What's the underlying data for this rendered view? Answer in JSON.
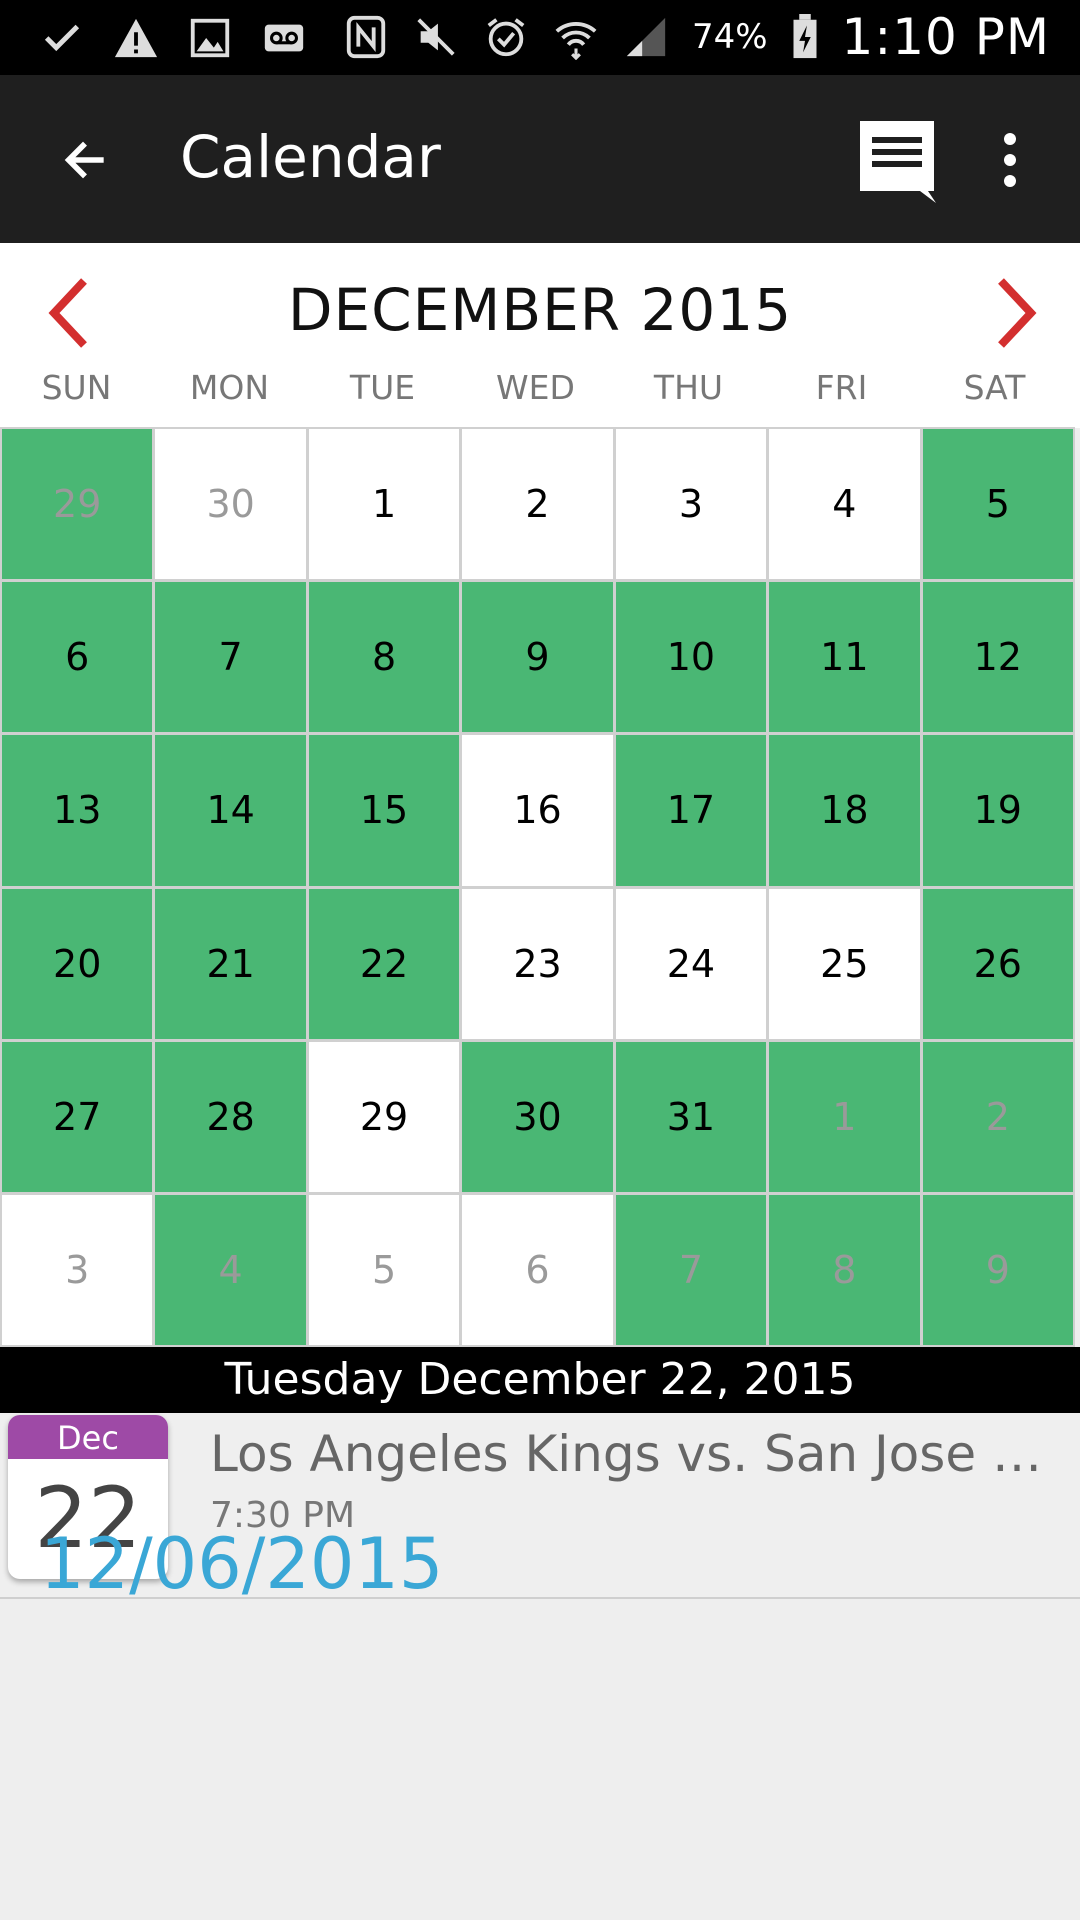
{
  "status_bar": {
    "left_icons": [
      "check-icon",
      "warning-icon",
      "image-icon",
      "voicemail-icon"
    ],
    "right_icons": [
      "nfc-icon",
      "mute-icon",
      "alarm-icon",
      "wifi-icon",
      "signal-icon"
    ],
    "battery": "74%",
    "time": "1:10 PM"
  },
  "app_bar": {
    "title": "Calendar"
  },
  "calendar": {
    "month_title": "DECEMBER 2015",
    "weekdays": [
      "SUN",
      "MON",
      "TUE",
      "WED",
      "THU",
      "FRI",
      "SAT"
    ],
    "days": [
      {
        "d": "29",
        "green": true,
        "other": true
      },
      {
        "d": "30",
        "green": false,
        "other": true
      },
      {
        "d": "1",
        "green": false,
        "other": false
      },
      {
        "d": "2",
        "green": false,
        "other": false
      },
      {
        "d": "3",
        "green": false,
        "other": false
      },
      {
        "d": "4",
        "green": false,
        "other": false
      },
      {
        "d": "5",
        "green": true,
        "other": false
      },
      {
        "d": "6",
        "green": true,
        "other": false
      },
      {
        "d": "7",
        "green": true,
        "other": false
      },
      {
        "d": "8",
        "green": true,
        "other": false
      },
      {
        "d": "9",
        "green": true,
        "other": false
      },
      {
        "d": "10",
        "green": true,
        "other": false
      },
      {
        "d": "11",
        "green": true,
        "other": false
      },
      {
        "d": "12",
        "green": true,
        "other": false
      },
      {
        "d": "13",
        "green": true,
        "other": false
      },
      {
        "d": "14",
        "green": true,
        "other": false
      },
      {
        "d": "15",
        "green": true,
        "other": false
      },
      {
        "d": "16",
        "green": false,
        "other": false
      },
      {
        "d": "17",
        "green": true,
        "other": false
      },
      {
        "d": "18",
        "green": true,
        "other": false
      },
      {
        "d": "19",
        "green": true,
        "other": false
      },
      {
        "d": "20",
        "green": true,
        "other": false
      },
      {
        "d": "21",
        "green": true,
        "other": false
      },
      {
        "d": "22",
        "green": true,
        "other": false
      },
      {
        "d": "23",
        "green": false,
        "other": false
      },
      {
        "d": "24",
        "green": false,
        "other": false
      },
      {
        "d": "25",
        "green": false,
        "other": false
      },
      {
        "d": "26",
        "green": true,
        "other": false
      },
      {
        "d": "27",
        "green": true,
        "other": false
      },
      {
        "d": "28",
        "green": true,
        "other": false
      },
      {
        "d": "29",
        "green": false,
        "other": false
      },
      {
        "d": "30",
        "green": true,
        "other": false
      },
      {
        "d": "31",
        "green": true,
        "other": false
      },
      {
        "d": "1",
        "green": true,
        "other": true
      },
      {
        "d": "2",
        "green": true,
        "other": true
      },
      {
        "d": "3",
        "green": false,
        "other": true
      },
      {
        "d": "4",
        "green": true,
        "other": true
      },
      {
        "d": "5",
        "green": false,
        "other": true
      },
      {
        "d": "6",
        "green": false,
        "other": true
      },
      {
        "d": "7",
        "green": true,
        "other": true
      },
      {
        "d": "8",
        "green": true,
        "other": true
      },
      {
        "d": "9",
        "green": true,
        "other": true
      }
    ],
    "colors": {
      "available": "#4ab774",
      "accent": "#d32f2f"
    }
  },
  "selected": {
    "date_label": "Tuesday December 22, 2015",
    "event": {
      "icon_month": "Dec",
      "icon_day": "22",
      "title": "Los Angeles Kings vs. San Jose Sh...",
      "time": "7:30 PM"
    }
  },
  "overlay_date": "12/06/2015"
}
